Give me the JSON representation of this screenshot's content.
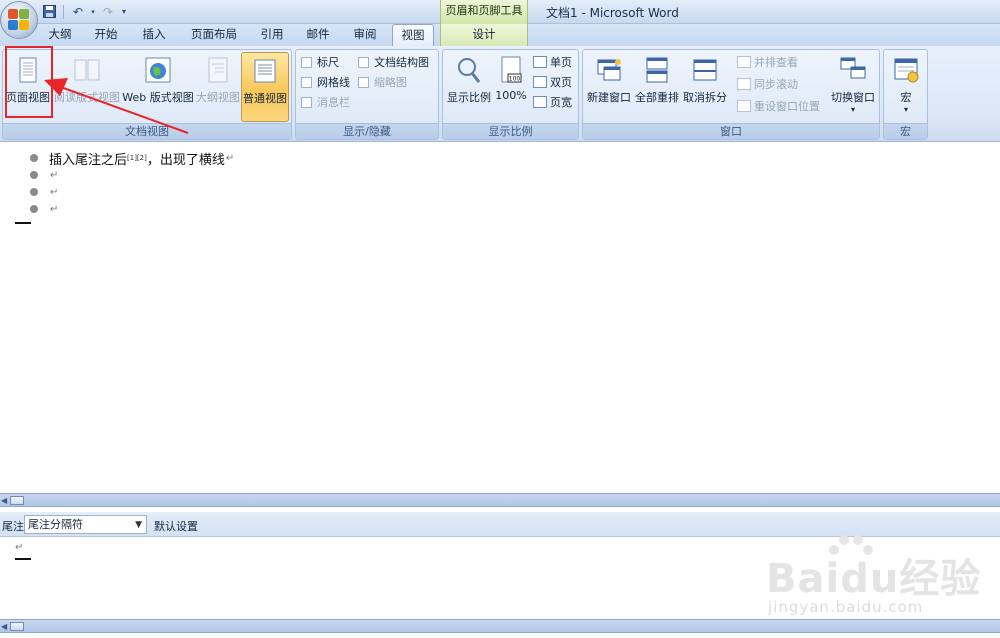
{
  "title_bar": {
    "window_title": "文档1 - Microsoft Word",
    "contextual_tab_group": "页眉和页脚工具",
    "quick_access": [
      {
        "icon": "save-icon"
      },
      {
        "icon": "undo-icon"
      },
      {
        "icon": "redo-icon"
      },
      {
        "icon": "customize-dropdown-icon"
      }
    ]
  },
  "tabs": [
    {
      "label": "大纲",
      "active": false
    },
    {
      "label": "开始",
      "active": false
    },
    {
      "label": "插入",
      "active": false
    },
    {
      "label": "页面布局",
      "active": false
    },
    {
      "label": "引用",
      "active": false
    },
    {
      "label": "邮件",
      "active": false
    },
    {
      "label": "审阅",
      "active": false
    },
    {
      "label": "视图",
      "active": true
    },
    {
      "label": "设计",
      "active": false,
      "contextual": true
    }
  ],
  "ribbon": {
    "doc_views": {
      "group_label": "文档视图",
      "buttons": [
        {
          "label": "页面视图",
          "enabled": true,
          "highlighted_by_annotation": true
        },
        {
          "label": "阅读版式视图",
          "enabled": false
        },
        {
          "label": "Web 版式视图",
          "enabled": true
        },
        {
          "label": "大纲视图",
          "enabled": false
        },
        {
          "label": "普通视图",
          "enabled": true,
          "selected": true
        }
      ]
    },
    "show_hide": {
      "group_label": "显示/隐藏",
      "checkboxes": [
        {
          "label": "标尺",
          "enabled": true
        },
        {
          "label": "网格线",
          "enabled": true
        },
        {
          "label": "消息栏",
          "enabled": false
        },
        {
          "label": "文档结构图",
          "enabled": true
        },
        {
          "label": "缩略图",
          "enabled": false
        }
      ]
    },
    "zoom": {
      "group_label": "显示比例",
      "zoom_label": "显示比例",
      "hundred_label": "100%",
      "hundred_icon_text": "100",
      "single_page": "单页",
      "two_pages": "双页",
      "page_width": "页宽"
    },
    "window": {
      "group_label": "窗口",
      "new_window": "新建窗口",
      "arrange_all": "全部重排",
      "remove_split": "取消拆分",
      "view_side_by_side": "并排查看",
      "sync_scrolling": "同步滚动",
      "reset_position": "重设窗口位置",
      "switch_windows": "切换窗口"
    },
    "macros": {
      "group_label": "宏",
      "button_label": "宏"
    }
  },
  "document": {
    "bullets": [
      {
        "text_before": "插入尾注之后",
        "superscript": "[1][2]",
        "text_after": "，出现了横线",
        "mark": "↵"
      },
      {
        "text_before": "",
        "superscript": "",
        "text_after": "",
        "mark": "↵"
      },
      {
        "text_before": "",
        "superscript": "",
        "text_after": "",
        "mark": "↵"
      },
      {
        "text_before": "",
        "superscript": "",
        "text_after": "",
        "mark": "↵"
      }
    ]
  },
  "notes_pane": {
    "label": "尾注",
    "selected_option": "尾注分隔符",
    "reset_label": "默认设置",
    "caret_mark": "↵"
  },
  "watermark": {
    "brand": "Baidu经验",
    "url": "jingyan.baidu.com"
  },
  "colors": {
    "ribbon_bg": "#dce8f7",
    "annotation_red": "#e8262a",
    "active_button": "#f9c75a",
    "contextual_tab": "#d3e6a9"
  }
}
